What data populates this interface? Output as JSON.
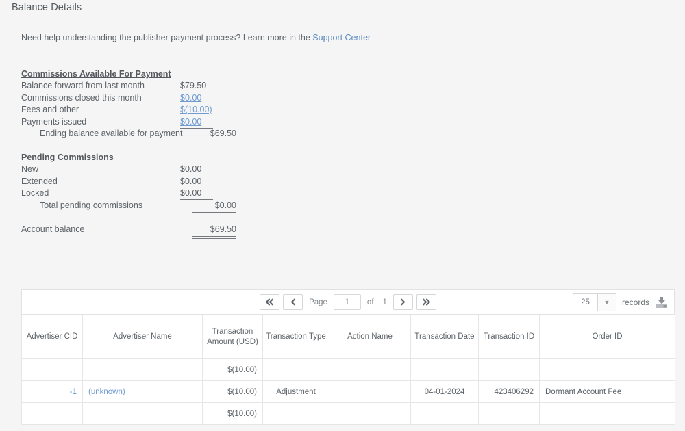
{
  "page": {
    "title": "Balance Details",
    "help_text": "Need help understanding the publisher payment process? Learn more in the ",
    "help_link": "Support Center"
  },
  "commissions_available": {
    "heading": "Commissions Available For Payment",
    "rows": [
      {
        "label": "Balance forward from last month",
        "value": "$79.50",
        "style": "dark"
      },
      {
        "label": "Commissions closed this month",
        "value": "$0.00",
        "style": "link"
      },
      {
        "label": "Fees and other",
        "value": "$(10.00)",
        "style": "link"
      },
      {
        "label": "Payments issued",
        "value": "$0.00",
        "style": "link"
      }
    ],
    "total_label": "Ending balance available for payment",
    "total_value": "$69.50"
  },
  "pending_commissions": {
    "heading": "Pending Commissions",
    "rows": [
      {
        "label": "New",
        "value": "$0.00",
        "style": "dark"
      },
      {
        "label": "Extended",
        "value": "$0.00",
        "style": "dark"
      },
      {
        "label": "Locked",
        "value": "$0.00",
        "style": "dark"
      }
    ],
    "total_label": "Total pending commissions",
    "total_value": "$0.00"
  },
  "account_balance": {
    "label": "Account balance",
    "value": "$69.50"
  },
  "toolbar": {
    "first_page_label": "«",
    "prev_page_label": "‹",
    "page_label": "Page",
    "page_value": "1",
    "of_label": "of",
    "total_pages": "1",
    "next_page_label": "›",
    "last_page_label": "»",
    "records_per_page": "25",
    "records_label": "records",
    "download_icon": "download-icon"
  },
  "table": {
    "columns": [
      "Advertiser CID",
      "Advertiser Name",
      "Transaction Amount (USD)",
      "Transaction Type",
      "Action Name",
      "Transaction Date",
      "Transaction ID",
      "Order ID"
    ],
    "rows": [
      {
        "advertiser_cid": "",
        "advertiser_name": "",
        "transaction_amount": "$(10.00)",
        "transaction_type": "",
        "action_name": "",
        "transaction_date": "",
        "transaction_id": "",
        "order_id": ""
      },
      {
        "advertiser_cid": "-1",
        "advertiser_name": "(unknown)",
        "transaction_amount": "$(10.00)",
        "transaction_type": "Adjustment",
        "action_name": "",
        "transaction_date": "04-01-2024",
        "transaction_id": "423406292",
        "order_id": "Dormant Account Fee"
      },
      {
        "advertiser_cid": "",
        "advertiser_name": "",
        "transaction_amount": "$(10.00)",
        "transaction_type": "",
        "action_name": "",
        "transaction_date": "",
        "transaction_id": "",
        "order_id": ""
      }
    ]
  },
  "colors": {
    "link": "#6f9bd1",
    "text": "#5d6368",
    "background": "#f5f5f5"
  }
}
